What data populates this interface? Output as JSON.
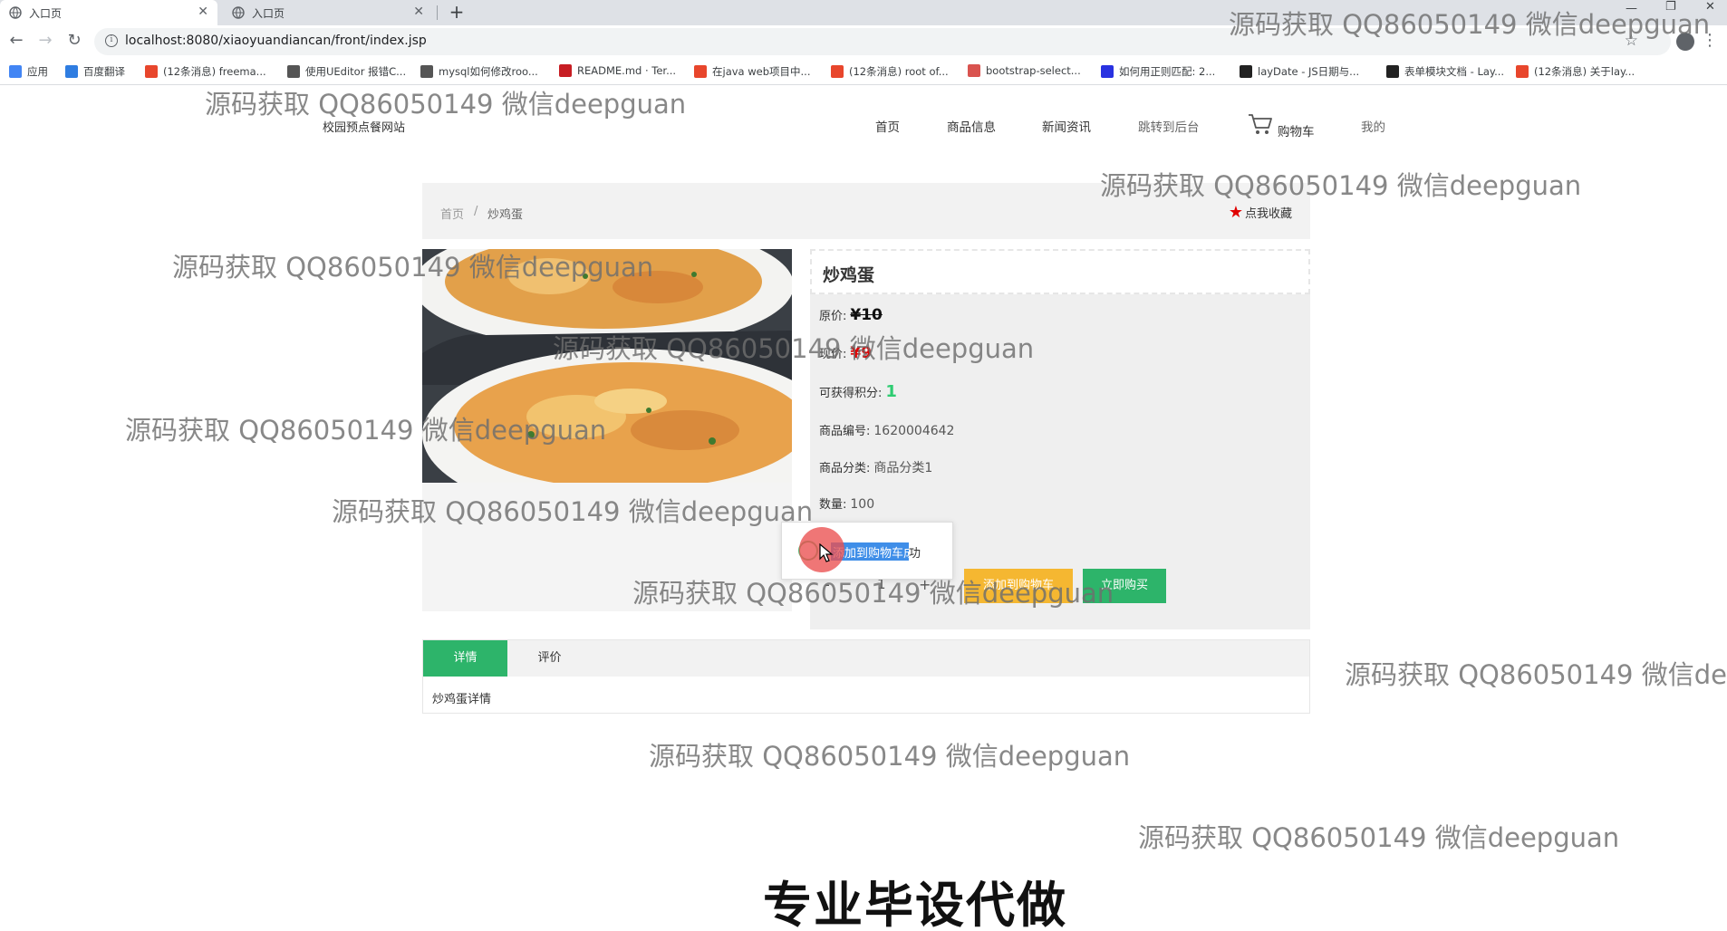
{
  "browser": {
    "tabs": [
      {
        "title": "入口页",
        "active": true
      },
      {
        "title": "入口页",
        "active": false
      }
    ],
    "new_tab_symbol": "+",
    "url": "localhost:8080/xiaoyuandiancan/front/index.jsp",
    "bookmarks": [
      {
        "label": "应用",
        "icon": "apps-icon",
        "color": "#4285f4"
      },
      {
        "label": "百度翻译",
        "icon": "baidu-translate-icon",
        "color": "#2f7de1"
      },
      {
        "label": "(12条消息) freema...",
        "icon": "csdn-icon",
        "color": "#e8462c"
      },
      {
        "label": "使用UEditor 报错C...",
        "icon": "ueditor-icon",
        "color": "#555555"
      },
      {
        "label": "mysql如何修改roo...",
        "icon": "mysql-icon",
        "color": "#555555"
      },
      {
        "label": "README.md · Ter...",
        "icon": "gitee-icon",
        "color": "#c71d23"
      },
      {
        "label": "在java web项目中...",
        "icon": "csdn-icon",
        "color": "#e8462c"
      },
      {
        "label": "(12条消息) root of...",
        "icon": "csdn-icon",
        "color": "#e8462c"
      },
      {
        "label": "bootstrap-select...",
        "icon": "bootstrap-icon",
        "color": "#d9534f"
      },
      {
        "label": "如何用正则匹配: 2...",
        "icon": "baidu-icon",
        "color": "#2932e1"
      },
      {
        "label": "layDate - JS日期与...",
        "icon": "layui-icon",
        "color": "#222222"
      },
      {
        "label": "表单模块文档 - Lay...",
        "icon": "layui-icon",
        "color": "#222222"
      },
      {
        "label": "(12条消息) 关于lay...",
        "icon": "csdn-icon",
        "color": "#e8462c"
      }
    ]
  },
  "site": {
    "name": "校园预点餐网站",
    "nav": [
      "首页",
      "商品信息",
      "新闻资讯",
      "跳转到后台",
      "购物车",
      "我的"
    ]
  },
  "breadcrumb": {
    "home": "首页",
    "separator": "/",
    "current": "炒鸡蛋",
    "favorite_label": "点我收藏"
  },
  "product": {
    "name": "炒鸡蛋",
    "original_price_label": "原价:",
    "original_price": "¥10",
    "current_price_label": "现价:",
    "current_price": "¥9",
    "points_label": "可获得积分:",
    "points": "1",
    "code_label": "商品编号:",
    "code": "1620004642",
    "category_label": "商品分类:",
    "category": "商品分类1",
    "stock_label": "数量:",
    "stock": "100",
    "qty_minus": "-",
    "qty_value": "1",
    "qty_plus": "+",
    "add_to_cart": "添加到购物车",
    "buy_now": "立即购买"
  },
  "toast": {
    "message_highlighted": "添加到购物车成",
    "message_tail": "功"
  },
  "detail_tabs": {
    "tabs": [
      "详情",
      "评价"
    ],
    "content": "炒鸡蛋详情"
  },
  "watermark": "源码获取 QQ86050149 微信deepguan",
  "caption": "专业毕设代做",
  "colors": {
    "accent_green": "#2db46a",
    "cart_button": "#f5b731",
    "price_red": "#e00000",
    "points_green": "#2ecc71"
  }
}
